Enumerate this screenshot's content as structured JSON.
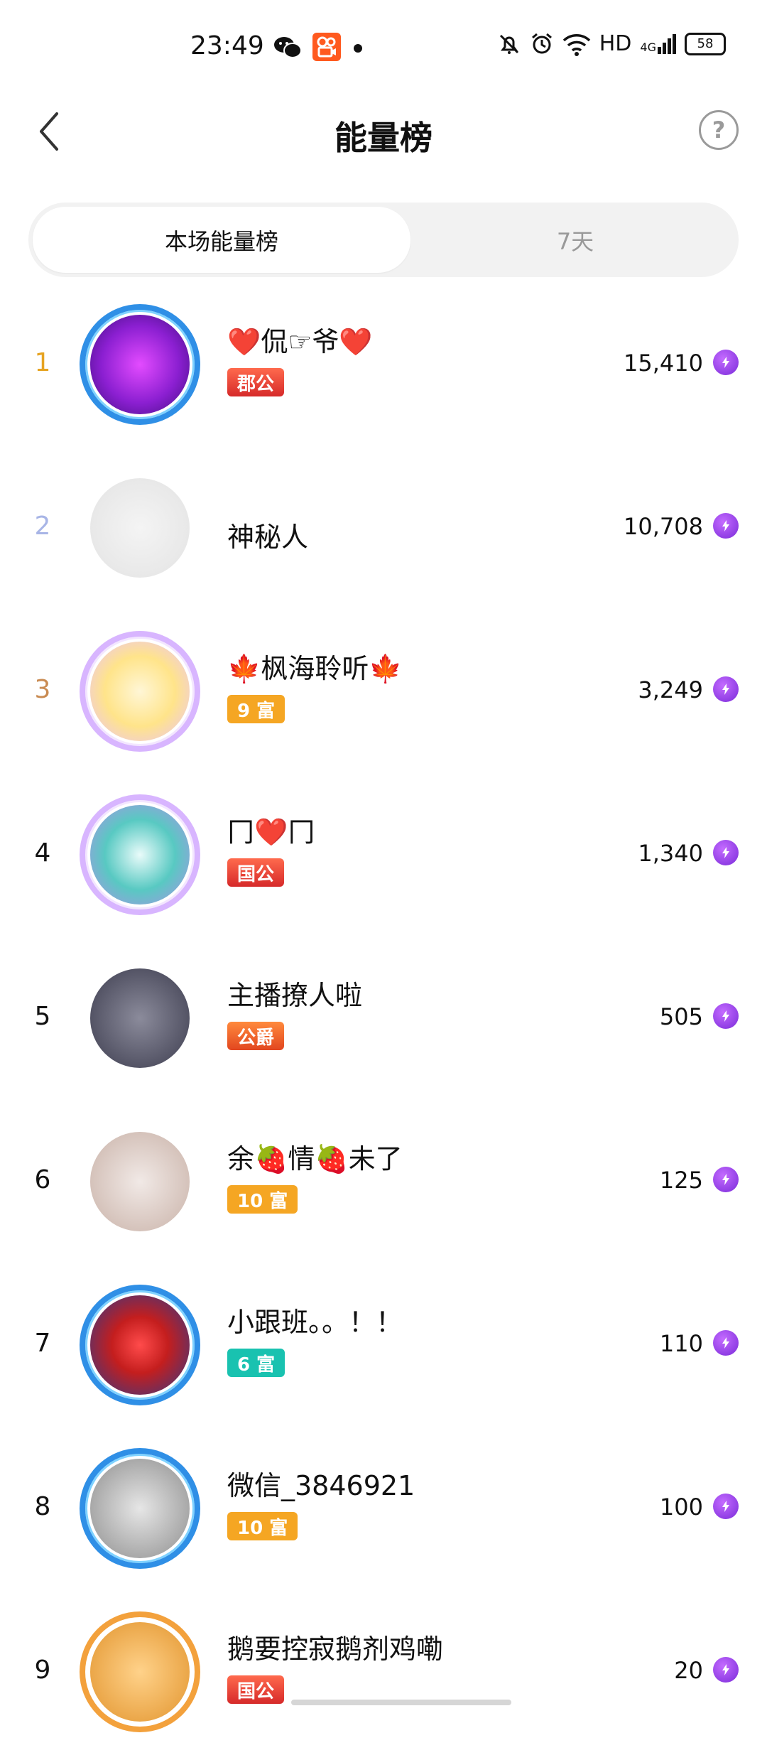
{
  "status_bar": {
    "time": "23:49",
    "network": "HD",
    "signal": "4G",
    "battery": "58"
  },
  "header": {
    "title": "能量榜"
  },
  "tabs": [
    {
      "label": "本场能量榜",
      "active": true
    },
    {
      "label": "7天",
      "active": false
    }
  ],
  "colors": {
    "rank1": "#e6a321",
    "rank2": "#a8b5e6",
    "rank3": "#c98b52",
    "badge_red": "#e53a3a",
    "badge_orange": "#f5a623",
    "badge_teal": "#19c2b0",
    "energy_purple": "#8a3ae3"
  },
  "leaderboard": [
    {
      "rank": "1",
      "name": "❤️侃☞爷❤️",
      "badge": "郡公",
      "badge_type": "red",
      "score": "15,410",
      "avatar_icon": "guard-frame-icon"
    },
    {
      "rank": "2",
      "name": "神秘人",
      "badge": "",
      "badge_type": "",
      "score": "10,708",
      "avatar_icon": "mystery-man-icon"
    },
    {
      "rank": "3",
      "name": "🍁枫海聆听🍁",
      "badge": "9 富",
      "badge_type": "orange",
      "score": "3,249",
      "avatar_icon": "maple-leaf-icon"
    },
    {
      "rank": "4",
      "name": "冂❤️冂",
      "badge": "国公",
      "badge_type": "red",
      "score": "1,340",
      "avatar_icon": "dragon-icon"
    },
    {
      "rank": "5",
      "name": "主播撩人啦",
      "badge": "公爵",
      "badge_type": "red-orange",
      "score": "505",
      "avatar_icon": "user-photo"
    },
    {
      "rank": "6",
      "name": "余🍓情🍓未了",
      "badge": "10 富",
      "badge_type": "orange",
      "score": "125",
      "avatar_icon": "user-photo"
    },
    {
      "rank": "7",
      "name": "小跟班。。！！",
      "badge": "6 富",
      "badge_type": "teal",
      "score": "110",
      "avatar_icon": "heart-icon"
    },
    {
      "rank": "8",
      "name": "微信_3846921",
      "badge": "10 富",
      "badge_type": "orange",
      "score": "100",
      "avatar_icon": "user-photo"
    },
    {
      "rank": "9",
      "name": "鹅要控寂鹅剂鸡嘞",
      "badge": "国公",
      "badge_type": "red",
      "score": "20",
      "avatar_icon": "cat-icon"
    }
  ]
}
